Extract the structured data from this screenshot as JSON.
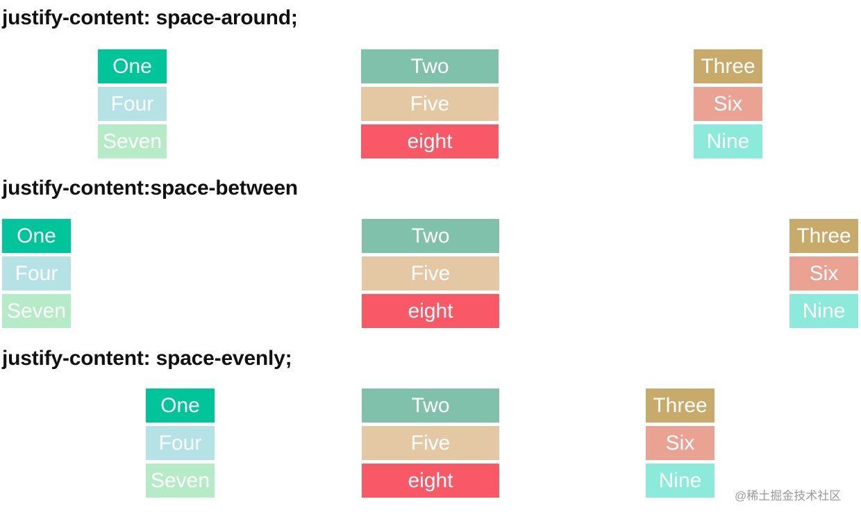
{
  "sections": [
    {
      "heading": "justify-content: space-around;",
      "columns": [
        {
          "items": [
            {
              "label": "One",
              "color": "#00c49a"
            },
            {
              "label": "Four",
              "color": "#b5e2e5"
            },
            {
              "label": "Seven",
              "color": "#b5ebc6"
            }
          ]
        },
        {
          "items": [
            {
              "label": "Two",
              "color": "#7fc1ab"
            },
            {
              "label": "Five",
              "color": "#e4c8a4"
            },
            {
              "label": "eight",
              "color": "#f95866"
            }
          ]
        },
        {
          "items": [
            {
              "label": "Three",
              "color": "#c8ab6a"
            },
            {
              "label": "Six",
              "color": "#eaa293"
            },
            {
              "label": "Nine",
              "color": "#8ceadb"
            }
          ]
        }
      ]
    },
    {
      "heading": "justify-content:space-between",
      "columns": [
        {
          "items": [
            {
              "label": "One",
              "color": "#00c49a"
            },
            {
              "label": "Four",
              "color": "#b5e2e5"
            },
            {
              "label": "Seven",
              "color": "#b5ebc6"
            }
          ]
        },
        {
          "items": [
            {
              "label": "Two",
              "color": "#7fc1ab"
            },
            {
              "label": "Five",
              "color": "#e4c8a4"
            },
            {
              "label": "eight",
              "color": "#f95866"
            }
          ]
        },
        {
          "items": [
            {
              "label": "Three",
              "color": "#c8ab6a"
            },
            {
              "label": "Six",
              "color": "#eaa293"
            },
            {
              "label": "Nine",
              "color": "#8ceadb"
            }
          ]
        }
      ]
    },
    {
      "heading": "justify-content: space-evenly;",
      "columns": [
        {
          "items": [
            {
              "label": "One",
              "color": "#00c49a"
            },
            {
              "label": "Four",
              "color": "#b5e2e5"
            },
            {
              "label": "Seven",
              "color": "#b5ebc6"
            }
          ]
        },
        {
          "items": [
            {
              "label": "Two",
              "color": "#7fc1ab"
            },
            {
              "label": "Five",
              "color": "#e4c8a4"
            },
            {
              "label": "eight",
              "color": "#f95866"
            }
          ]
        },
        {
          "items": [
            {
              "label": "Three",
              "color": "#c8ab6a"
            },
            {
              "label": "Six",
              "color": "#eaa293"
            },
            {
              "label": "Nine",
              "color": "#8ceadb"
            }
          ]
        }
      ]
    }
  ],
  "watermark": "@稀土掘金技术社区"
}
